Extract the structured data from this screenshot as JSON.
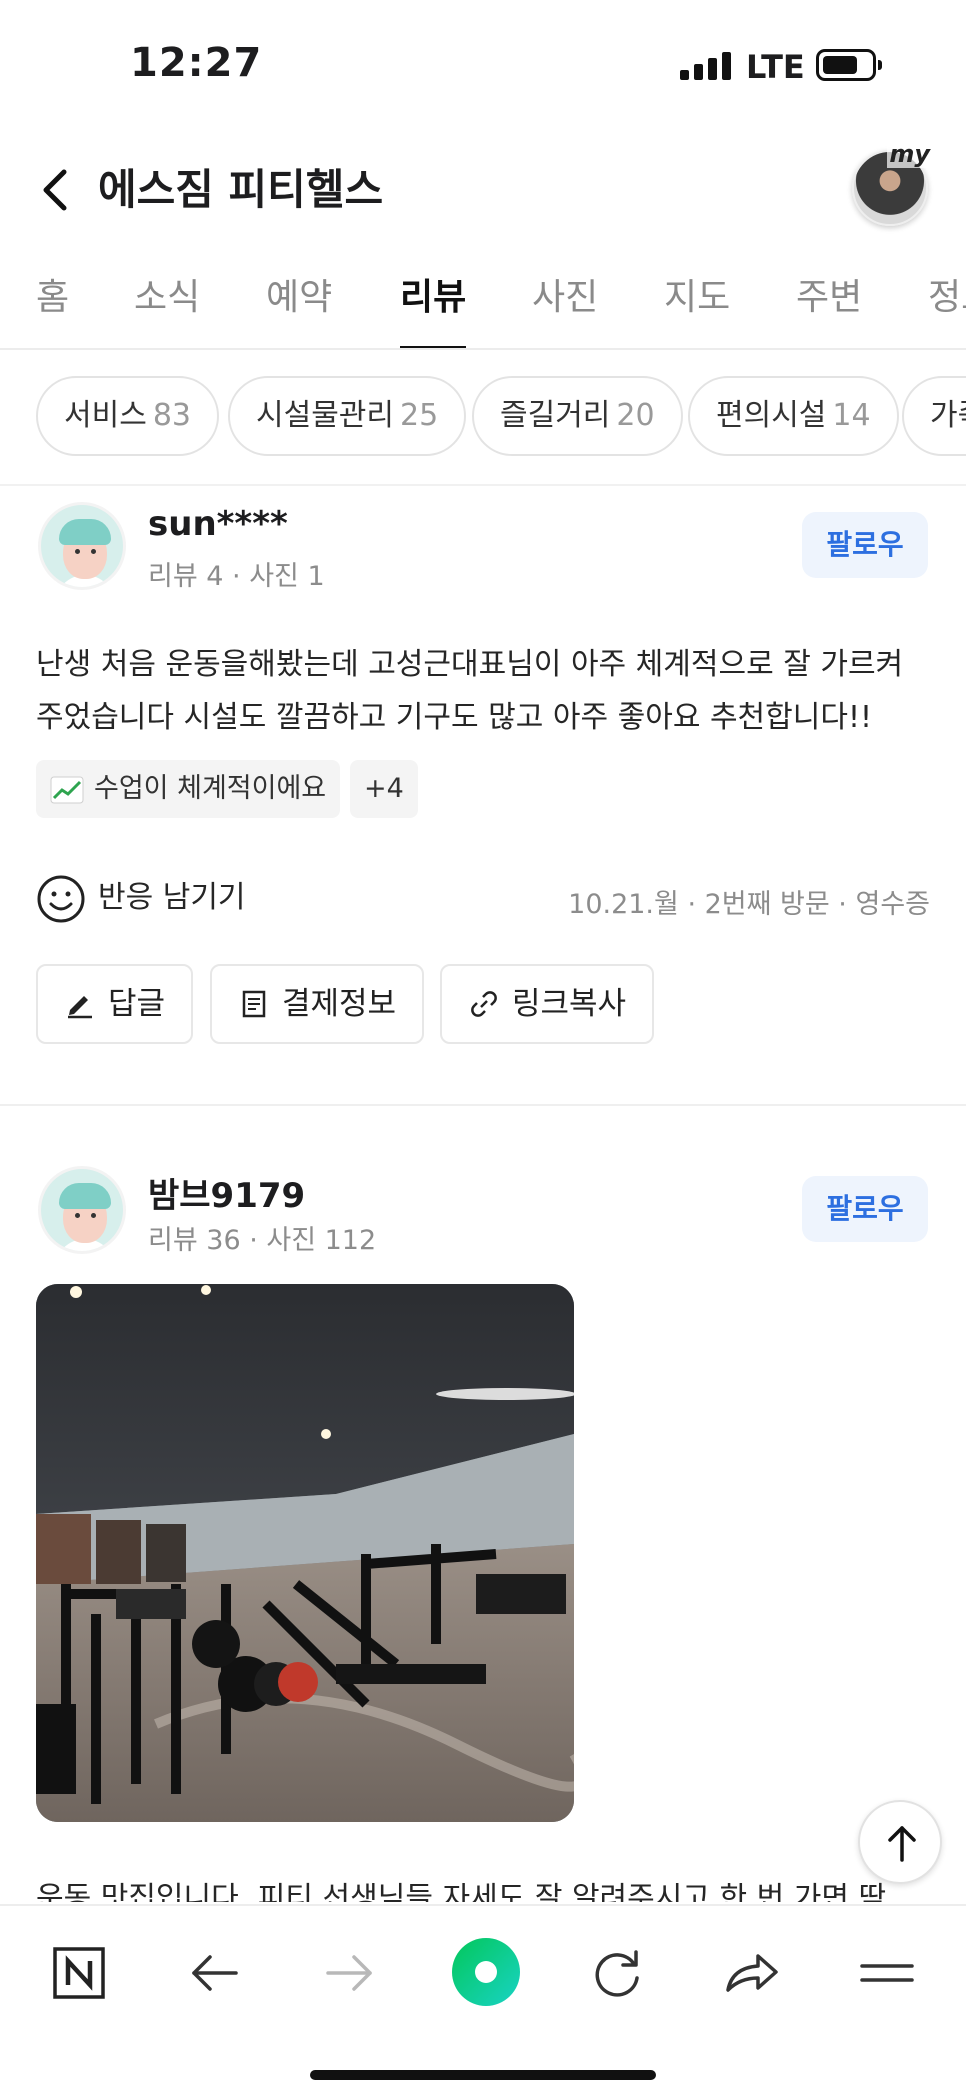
{
  "status": {
    "time": "12:27",
    "network": "LTE"
  },
  "header": {
    "title": "에스짐 피티헬스",
    "avatar_badge": "my"
  },
  "tabs": [
    "홈",
    "소식",
    "예약",
    "리뷰",
    "사진",
    "지도",
    "주변",
    "정보"
  ],
  "active_tab": "리뷰",
  "chips": [
    {
      "label": "서비스",
      "count": "83"
    },
    {
      "label": "시설물관리",
      "count": "25"
    },
    {
      "label": "즐길거리",
      "count": "20"
    },
    {
      "label": "편의시설",
      "count": "14"
    },
    {
      "label": "가족",
      "count": ""
    }
  ],
  "reviews": [
    {
      "user": "sun****",
      "meta": "리뷰 4 · 사진 1",
      "follow": "팔로우",
      "text": "난생 처음 운동을해봤는데 고성근대표님이 아주 체계적으로 잘 가르켜 주었습니다 시설도 깔끔하고 기구도 많고 아주 좋아요 추천합니다!!",
      "tag": "수업이 체계적이에요",
      "tag_more": "+4",
      "react": "반응 남기기",
      "visit": "10.21.월 · 2번째 방문 · 영수증",
      "actions": {
        "reply": "답글",
        "payment": "결제정보",
        "copy_link": "링크복사"
      }
    },
    {
      "user": "밤브9179",
      "meta": "리뷰 36 · 사진 112",
      "follow": "팔로우",
      "text_preview": "운동 맛집입니다. 피티 선생님들 자세도 잘 알려주시고 한 번 가면 딱"
    }
  ],
  "colors": {
    "accent_blue": "#2d6fe0",
    "naver_green": "#03c75a"
  }
}
